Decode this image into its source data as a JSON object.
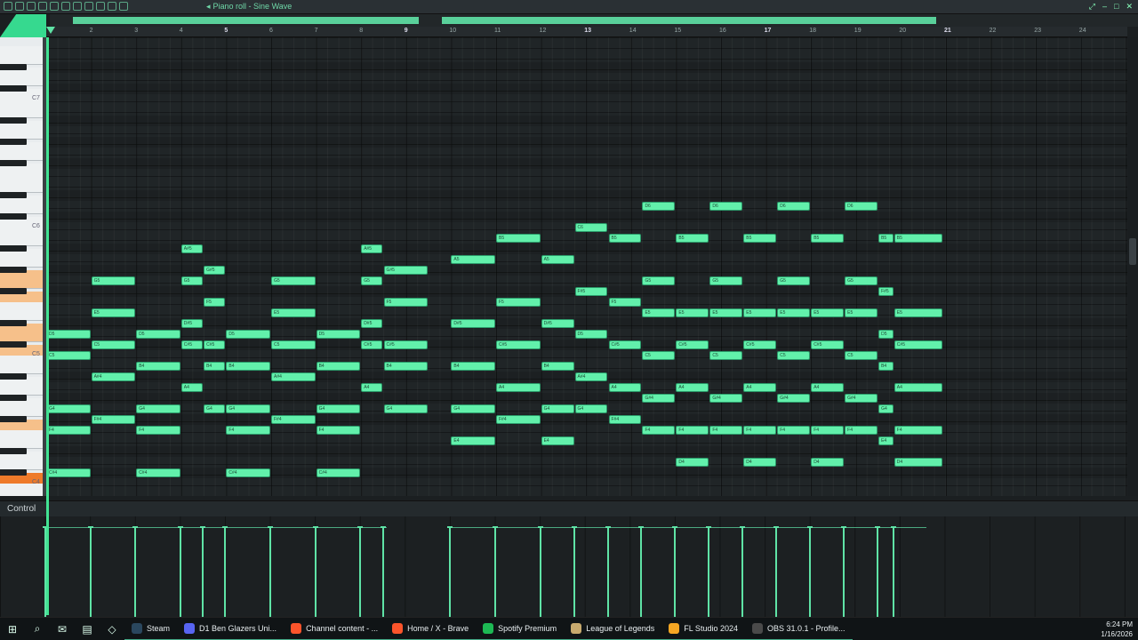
{
  "window": {
    "title": "Piano roll - Sine Wave"
  },
  "ruler": {
    "bars": [
      "2",
      "3",
      "4",
      "5",
      "6",
      "7",
      "8",
      "9",
      "10",
      "11",
      "12",
      "13",
      "14",
      "15",
      "16",
      "17",
      "18",
      "19",
      "20",
      "21",
      "22",
      "23",
      "24"
    ]
  },
  "keyboard": {
    "labels": [
      "C7",
      "C6",
      "C5",
      "C4"
    ]
  },
  "notes": [
    {
      "label": "D5",
      "bar": 1,
      "len": 1,
      "row": "D5"
    },
    {
      "label": "C5",
      "bar": 1,
      "len": 1,
      "row": "C5"
    },
    {
      "label": "G4",
      "bar": 1,
      "len": 1,
      "row": "G4"
    },
    {
      "label": "F4",
      "bar": 1,
      "len": 1,
      "row": "F4"
    },
    {
      "label": "C#4",
      "bar": 1,
      "len": 1,
      "row": "C#4"
    },
    {
      "label": "G5",
      "bar": 2,
      "len": 1,
      "row": "G5"
    },
    {
      "label": "E5",
      "bar": 2,
      "len": 1,
      "row": "E5"
    },
    {
      "label": "C5",
      "bar": 2,
      "len": 1,
      "row": "C#5"
    },
    {
      "label": "A#4",
      "bar": 2,
      "len": 1,
      "row": "A#4"
    },
    {
      "label": "F#4",
      "bar": 2,
      "len": 1,
      "row": "F#4"
    },
    {
      "label": "D5",
      "bar": 3,
      "len": 1,
      "row": "D5"
    },
    {
      "label": "B4",
      "bar": 3,
      "len": 1,
      "row": "B4"
    },
    {
      "label": "G4",
      "bar": 3,
      "len": 1,
      "row": "G4"
    },
    {
      "label": "F4",
      "bar": 3,
      "len": 1,
      "row": "F4"
    },
    {
      "label": "C#4",
      "bar": 3,
      "len": 1,
      "row": "C#4"
    },
    {
      "label": "A#5",
      "bar": 4,
      "len": 0.5,
      "row": "A#5"
    },
    {
      "label": "G#5",
      "bar": 4.5,
      "len": 0.5,
      "row": "G#5"
    },
    {
      "label": "G5",
      "bar": 4,
      "len": 0.5,
      "row": "G5"
    },
    {
      "label": "F5",
      "bar": 4.5,
      "len": 0.5,
      "row": "F5"
    },
    {
      "label": "D#5",
      "bar": 4,
      "len": 0.5,
      "row": "D#5"
    },
    {
      "label": "C#5",
      "bar": 4,
      "len": 0.5,
      "row": "C#5"
    },
    {
      "label": "C#5",
      "bar": 4.5,
      "len": 0.5,
      "row": "C#5"
    },
    {
      "label": "B4",
      "bar": 4.5,
      "len": 0.5,
      "row": "B4"
    },
    {
      "label": "A4",
      "bar": 4,
      "len": 0.5,
      "row": "A4"
    },
    {
      "label": "G4",
      "bar": 4.5,
      "len": 0.5,
      "row": "G4"
    },
    {
      "label": "D5",
      "bar": 5,
      "len": 1,
      "row": "D5"
    },
    {
      "label": "B4",
      "bar": 5,
      "len": 1,
      "row": "B4"
    },
    {
      "label": "G4",
      "bar": 5,
      "len": 1,
      "row": "G4"
    },
    {
      "label": "F4",
      "bar": 5,
      "len": 1,
      "row": "F4"
    },
    {
      "label": "C#4",
      "bar": 5,
      "len": 1,
      "row": "C#4"
    },
    {
      "label": "G5",
      "bar": 6,
      "len": 1,
      "row": "G5"
    },
    {
      "label": "E5",
      "bar": 6,
      "len": 1,
      "row": "E5"
    },
    {
      "label": "C5",
      "bar": 6,
      "len": 1,
      "row": "C#5"
    },
    {
      "label": "A#4",
      "bar": 6,
      "len": 1,
      "row": "A#4"
    },
    {
      "label": "F#4",
      "bar": 6,
      "len": 1,
      "row": "F#4"
    },
    {
      "label": "D5",
      "bar": 7,
      "len": 1,
      "row": "D5"
    },
    {
      "label": "B4",
      "bar": 7,
      "len": 1,
      "row": "B4"
    },
    {
      "label": "G4",
      "bar": 7,
      "len": 1,
      "row": "G4"
    },
    {
      "label": "F4",
      "bar": 7,
      "len": 1,
      "row": "F4"
    },
    {
      "label": "C#4",
      "bar": 7,
      "len": 1,
      "row": "C#4"
    },
    {
      "label": "A#5",
      "bar": 8,
      "len": 0.5,
      "row": "A#5"
    },
    {
      "label": "G5",
      "bar": 8,
      "len": 0.5,
      "row": "G5"
    },
    {
      "label": "D#5",
      "bar": 8,
      "len": 0.5,
      "row": "D#5"
    },
    {
      "label": "C#5",
      "bar": 8,
      "len": 0.5,
      "row": "C#5"
    },
    {
      "label": "A4",
      "bar": 8,
      "len": 0.5,
      "row": "A4"
    },
    {
      "label": "G#5",
      "bar": 8.5,
      "len": 1,
      "row": "G#5"
    },
    {
      "label": "F5",
      "bar": 8.5,
      "len": 1,
      "row": "F5"
    },
    {
      "label": "C#5",
      "bar": 8.5,
      "len": 1,
      "row": "C#5"
    },
    {
      "label": "B4",
      "bar": 8.5,
      "len": 1,
      "row": "B4"
    },
    {
      "label": "G4",
      "bar": 8.5,
      "len": 1,
      "row": "G4"
    },
    {
      "label": "A5",
      "bar": 10,
      "len": 1,
      "row": "A5"
    },
    {
      "label": "D#5",
      "bar": 10,
      "len": 1,
      "row": "D#5"
    },
    {
      "label": "B4",
      "bar": 10,
      "len": 1,
      "row": "B4"
    },
    {
      "label": "G4",
      "bar": 10,
      "len": 1,
      "row": "G4"
    },
    {
      "label": "E4",
      "bar": 10,
      "len": 1,
      "row": "E4"
    },
    {
      "label": "B5",
      "bar": 11,
      "len": 1,
      "row": "B5"
    },
    {
      "label": "F5",
      "bar": 11,
      "len": 1,
      "row": "F5"
    },
    {
      "label": "C#5",
      "bar": 11,
      "len": 1,
      "row": "C#5"
    },
    {
      "label": "A4",
      "bar": 11,
      "len": 1,
      "row": "A4"
    },
    {
      "label": "F#4",
      "bar": 11,
      "len": 1,
      "row": "F#4"
    },
    {
      "label": "A5",
      "bar": 12,
      "len": 0.75,
      "row": "A5"
    },
    {
      "label": "D#5",
      "bar": 12,
      "len": 0.75,
      "row": "D#5"
    },
    {
      "label": "B4",
      "bar": 12,
      "len": 0.75,
      "row": "B4"
    },
    {
      "label": "G4",
      "bar": 12,
      "len": 0.75,
      "row": "G4"
    },
    {
      "label": "E4",
      "bar": 12,
      "len": 0.75,
      "row": "E4"
    },
    {
      "label": "C6",
      "bar": 12.75,
      "len": 0.75,
      "row": "C6"
    },
    {
      "label": "F#5",
      "bar": 12.75,
      "len": 0.75,
      "row": "F#5"
    },
    {
      "label": "D5",
      "bar": 12.75,
      "len": 0.75,
      "row": "D5"
    },
    {
      "label": "A#4",
      "bar": 12.75,
      "len": 0.75,
      "row": "A#4"
    },
    {
      "label": "G4",
      "bar": 12.75,
      "len": 0.75,
      "row": "G4"
    },
    {
      "label": "B5",
      "bar": 13.5,
      "len": 0.75,
      "row": "B5"
    },
    {
      "label": "F5",
      "bar": 13.5,
      "len": 0.75,
      "row": "F5"
    },
    {
      "label": "C#5",
      "bar": 13.5,
      "len": 0.75,
      "row": "C#5"
    },
    {
      "label": "A4",
      "bar": 13.5,
      "len": 0.75,
      "row": "A4"
    },
    {
      "label": "F#4",
      "bar": 13.5,
      "len": 0.75,
      "row": "F#4"
    },
    {
      "label": "D6",
      "bar": 14.25,
      "len": 0.75,
      "row": "D6"
    },
    {
      "label": "G5",
      "bar": 14.25,
      "len": 0.75,
      "row": "G5"
    },
    {
      "label": "E5",
      "bar": 14.25,
      "len": 0.75,
      "row": "E5"
    },
    {
      "label": "C5",
      "bar": 14.25,
      "len": 0.75,
      "row": "C5"
    },
    {
      "label": "G#4",
      "bar": 14.25,
      "len": 0.75,
      "row": "G#4"
    },
    {
      "label": "F4",
      "bar": 14.25,
      "len": 0.75,
      "row": "F4"
    },
    {
      "label": "B5",
      "bar": 15,
      "len": 0.75,
      "row": "B5"
    },
    {
      "label": "E5",
      "bar": 15,
      "len": 0.75,
      "row": "E5"
    },
    {
      "label": "C#5",
      "bar": 15,
      "len": 0.75,
      "row": "C#5"
    },
    {
      "label": "A4",
      "bar": 15,
      "len": 0.75,
      "row": "A4"
    },
    {
      "label": "F4",
      "bar": 15,
      "len": 0.75,
      "row": "F4"
    },
    {
      "label": "D4",
      "bar": 15,
      "len": 0.75,
      "row": "D4"
    },
    {
      "label": "D6",
      "bar": 15.75,
      "len": 0.75,
      "row": "D6"
    },
    {
      "label": "G5",
      "bar": 15.75,
      "len": 0.75,
      "row": "G5"
    },
    {
      "label": "E5",
      "bar": 15.75,
      "len": 0.75,
      "row": "E5"
    },
    {
      "label": "C5",
      "bar": 15.75,
      "len": 0.75,
      "row": "C5"
    },
    {
      "label": "G#4",
      "bar": 15.75,
      "len": 0.75,
      "row": "G#4"
    },
    {
      "label": "F4",
      "bar": 15.75,
      "len": 0.75,
      "row": "F4"
    },
    {
      "label": "B5",
      "bar": 16.5,
      "len": 0.75,
      "row": "B5"
    },
    {
      "label": "E5",
      "bar": 16.5,
      "len": 0.75,
      "row": "E5"
    },
    {
      "label": "C#5",
      "bar": 16.5,
      "len": 0.75,
      "row": "C#5"
    },
    {
      "label": "A4",
      "bar": 16.5,
      "len": 0.75,
      "row": "A4"
    },
    {
      "label": "F4",
      "bar": 16.5,
      "len": 0.75,
      "row": "F4"
    },
    {
      "label": "D4",
      "bar": 16.5,
      "len": 0.75,
      "row": "D4"
    },
    {
      "label": "D6",
      "bar": 17.25,
      "len": 0.75,
      "row": "D6"
    },
    {
      "label": "G5",
      "bar": 17.25,
      "len": 0.75,
      "row": "G5"
    },
    {
      "label": "E5",
      "bar": 17.25,
      "len": 0.75,
      "row": "E5"
    },
    {
      "label": "C5",
      "bar": 17.25,
      "len": 0.75,
      "row": "C5"
    },
    {
      "label": "G#4",
      "bar": 17.25,
      "len": 0.75,
      "row": "G#4"
    },
    {
      "label": "F4",
      "bar": 17.25,
      "len": 0.75,
      "row": "F4"
    },
    {
      "label": "B5",
      "bar": 18,
      "len": 0.75,
      "row": "B5"
    },
    {
      "label": "E5",
      "bar": 18,
      "len": 0.75,
      "row": "E5"
    },
    {
      "label": "C#5",
      "bar": 18,
      "len": 0.75,
      "row": "C#5"
    },
    {
      "label": "A4",
      "bar": 18,
      "len": 0.75,
      "row": "A4"
    },
    {
      "label": "F4",
      "bar": 18,
      "len": 0.75,
      "row": "F4"
    },
    {
      "label": "D4",
      "bar": 18,
      "len": 0.75,
      "row": "D4"
    },
    {
      "label": "D6",
      "bar": 18.75,
      "len": 0.75,
      "row": "D6"
    },
    {
      "label": "G5",
      "bar": 18.75,
      "len": 0.75,
      "row": "G5"
    },
    {
      "label": "E5",
      "bar": 18.75,
      "len": 0.75,
      "row": "E5"
    },
    {
      "label": "C5",
      "bar": 18.75,
      "len": 0.75,
      "row": "C5"
    },
    {
      "label": "G#4",
      "bar": 18.75,
      "len": 0.75,
      "row": "G#4"
    },
    {
      "label": "F4",
      "bar": 18.75,
      "len": 0.75,
      "row": "F4"
    },
    {
      "label": "B5",
      "bar": 19.5,
      "len": 0.35,
      "row": "B5"
    },
    {
      "label": "F#5",
      "bar": 19.5,
      "len": 0.35,
      "row": "F#5"
    },
    {
      "label": "D5",
      "bar": 19.5,
      "len": 0.35,
      "row": "D5"
    },
    {
      "label": "B4",
      "bar": 19.5,
      "len": 0.35,
      "row": "B4"
    },
    {
      "label": "G4",
      "bar": 19.5,
      "len": 0.35,
      "row": "G4"
    },
    {
      "label": "E4",
      "bar": 19.5,
      "len": 0.35,
      "row": "E4"
    },
    {
      "label": "B5",
      "bar": 19.85,
      "len": 1.1,
      "row": "B5"
    },
    {
      "label": "E5",
      "bar": 19.85,
      "len": 1.1,
      "row": "E5"
    },
    {
      "label": "C#5",
      "bar": 19.85,
      "len": 1.1,
      "row": "C#5"
    },
    {
      "label": "A4",
      "bar": 19.85,
      "len": 1.1,
      "row": "A4"
    },
    {
      "label": "F4",
      "bar": 19.85,
      "len": 1.1,
      "row": "F4"
    },
    {
      "label": "D4",
      "bar": 19.85,
      "len": 1.1,
      "row": "D4"
    }
  ],
  "control": {
    "label": "Control"
  },
  "taskbar": {
    "items": [
      {
        "label": "Steam",
        "color": "#2a475e"
      },
      {
        "label": "D1 Ben Glazers Uni...",
        "color": "#5865f2"
      },
      {
        "label": "Channel content - ...",
        "color": "#fb542b"
      },
      {
        "label": "Home / X - Brave",
        "color": "#fb542b"
      },
      {
        "label": "Spotify Premium",
        "color": "#1db954"
      },
      {
        "label": "League of Legends",
        "color": "#c8aa6e"
      },
      {
        "label": "FL Studio 2024",
        "color": "#f5a623"
      },
      {
        "label": "OBS 31.0.1 - Profile...",
        "color": "#4a4a4a"
      }
    ],
    "time": "6:24 PM",
    "date": "1/16/2026"
  },
  "colors": {
    "note": "#62f0ab",
    "accent": "#36d98f",
    "grid_bg": "#202527"
  }
}
